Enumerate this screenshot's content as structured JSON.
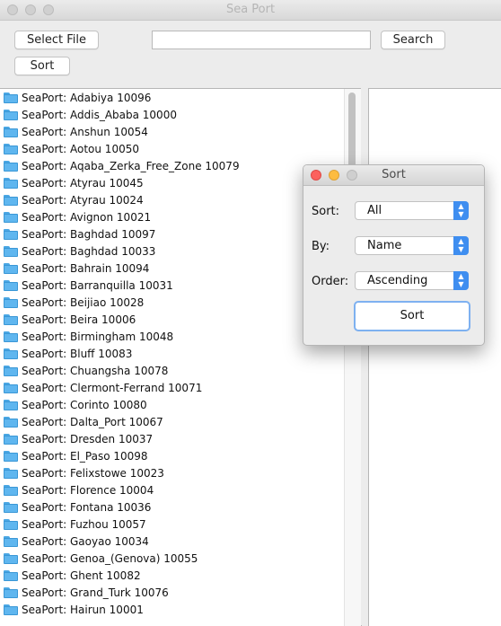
{
  "window": {
    "title": "Sea Port"
  },
  "toolbar": {
    "select_file_label": "Select File",
    "search_label": "Search",
    "sort_label": "Sort",
    "search_value": ""
  },
  "tree": {
    "items": [
      "SeaPort: Adabiya 10096",
      "SeaPort: Addis_Ababa 10000",
      "SeaPort: Anshun 10054",
      "SeaPort: Aotou 10050",
      "SeaPort: Aqaba_Zerka_Free_Zone 10079",
      "SeaPort: Atyrau 10045",
      "SeaPort: Atyrau 10024",
      "SeaPort: Avignon 10021",
      "SeaPort: Baghdad 10097",
      "SeaPort: Baghdad 10033",
      "SeaPort: Bahrain 10094",
      "SeaPort: Barranquilla 10031",
      "SeaPort: Beijiao 10028",
      "SeaPort: Beira 10006",
      "SeaPort: Birmingham 10048",
      "SeaPort: Bluff 10083",
      "SeaPort: Chuangsha 10078",
      "SeaPort: Clermont-Ferrand 10071",
      "SeaPort: Corinto 10080",
      "SeaPort: Dalta_Port 10067",
      "SeaPort: Dresden 10037",
      "SeaPort: El_Paso 10098",
      "SeaPort: Felixstowe 10023",
      "SeaPort: Florence 10004",
      "SeaPort: Fontana 10036",
      "SeaPort: Fuzhou 10057",
      "SeaPort: Gaoyao 10034",
      "SeaPort: Genoa_(Genova) 10055",
      "SeaPort: Ghent 10082",
      "SeaPort: Grand_Turk 10076",
      "SeaPort: Hairun 10001"
    ]
  },
  "dialog": {
    "title": "Sort",
    "sort_label": "Sort:",
    "sort_value": "All",
    "by_label": "By:",
    "by_value": "Name",
    "order_label": "Order:",
    "order_value": "Ascending",
    "button_label": "Sort"
  },
  "colors": {
    "folder": "#5fb6ef",
    "select_arrow": "#3f8ef0",
    "close": "#fc615d",
    "minimize": "#fdbc40"
  },
  "icons": {
    "tree_item": "folder-icon",
    "select_arrows": "updown-chevron-icon"
  }
}
